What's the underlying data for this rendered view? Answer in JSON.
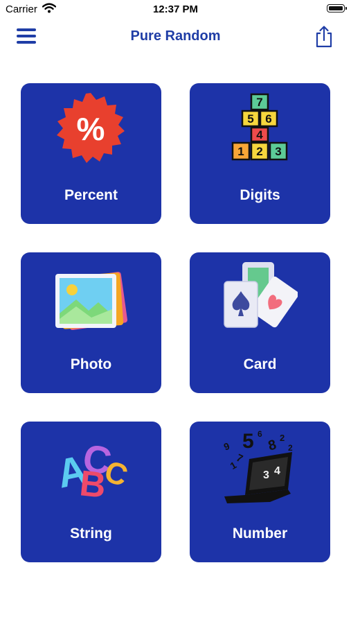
{
  "status_bar": {
    "carrier": "Carrier",
    "time": "12:37 PM",
    "icons": [
      "wifi-icon",
      "battery-icon"
    ]
  },
  "nav": {
    "title": "Pure Random",
    "left_icon": "hamburger-menu-icon",
    "right_icon": "share-icon",
    "accent_color": "#1F3DA6"
  },
  "tiles": [
    {
      "label": "Percent",
      "icon": "percent-badge-icon"
    },
    {
      "label": "Digits",
      "icon": "hopscotch-digits-icon"
    },
    {
      "label": "Photo",
      "icon": "photo-stack-icon"
    },
    {
      "label": "Card",
      "icon": "playing-cards-icon"
    },
    {
      "label": "String",
      "icon": "abc-letters-icon"
    },
    {
      "label": "Number",
      "icon": "laptop-numbers-icon"
    }
  ],
  "colors": {
    "tile_background": "#1D33A8",
    "tile_text": "#FFFFFF",
    "page_background": "#FFFFFF"
  },
  "icon_text": {
    "percent_symbol": "%",
    "digits": [
      "7",
      "5",
      "6",
      "4",
      "1",
      "2",
      "3"
    ],
    "letters": [
      "A",
      "B",
      "C"
    ],
    "numbers": [
      "5",
      "3",
      "8",
      "2",
      "1",
      "4",
      "9",
      "7",
      "6",
      "2"
    ]
  }
}
